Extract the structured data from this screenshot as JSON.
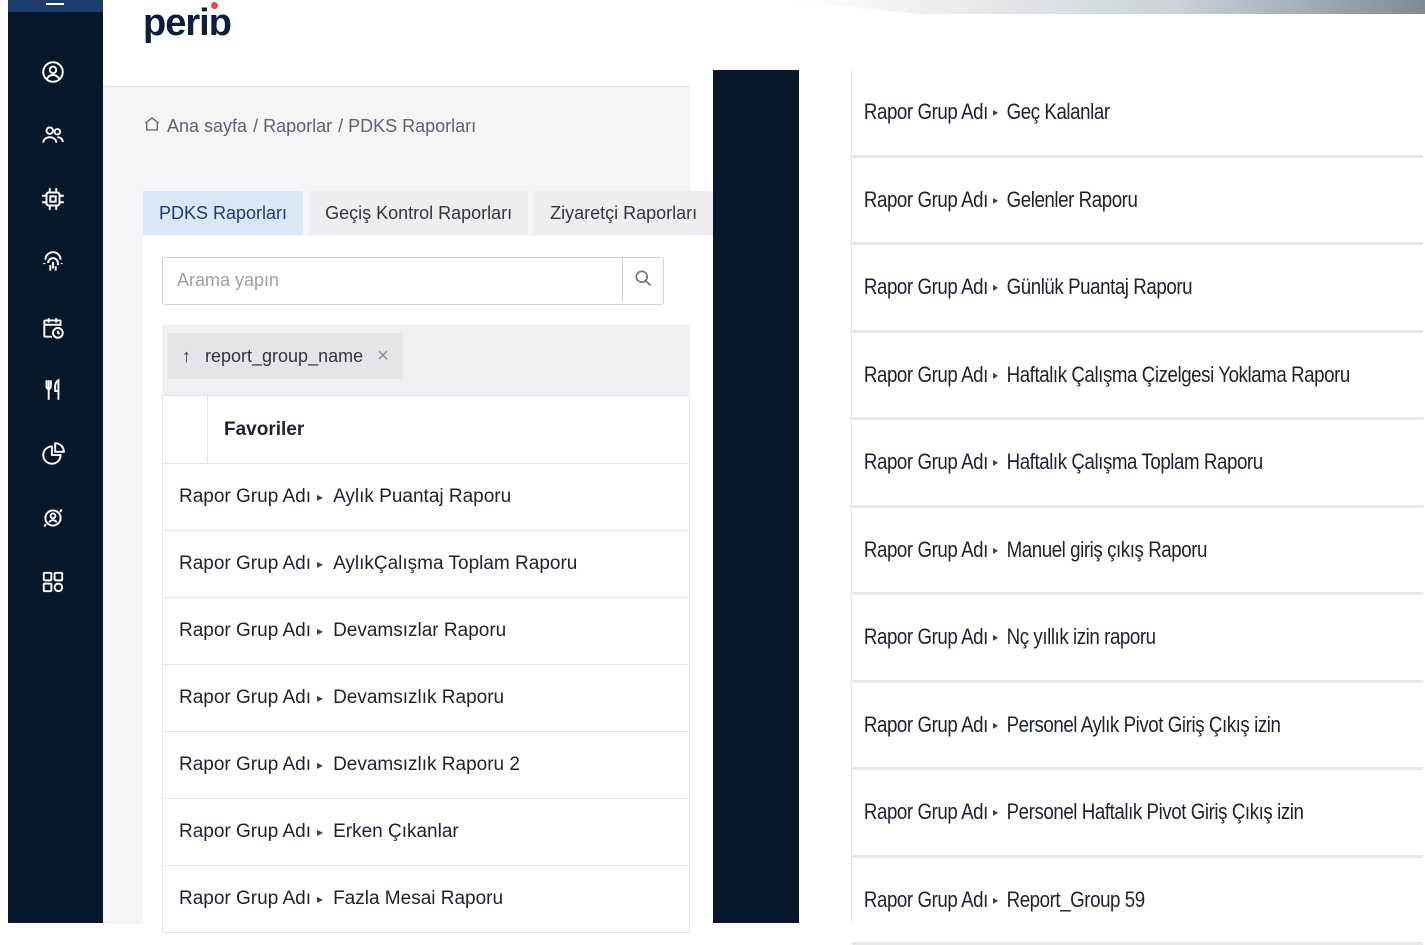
{
  "logo": {
    "text": "periɒ"
  },
  "breadcrumb": {
    "home": "Ana sayfa",
    "items": [
      "/ Raporlar",
      "/ PDKS Raporları"
    ]
  },
  "tabs": [
    {
      "label": "PDKS Raporları",
      "active": true
    },
    {
      "label": "Geçiş Kontrol Raporları",
      "active": false
    },
    {
      "label": "Ziyaretçi Raporları",
      "active": false
    }
  ],
  "search": {
    "placeholder": "Arama yapın"
  },
  "grouping": {
    "arrow": "↑",
    "field": "report_group_name",
    "remove": "×"
  },
  "list": {
    "favorites_label": "Favoriler",
    "group_label": "Rapor Grup Adı",
    "left_rows": [
      "Aylık Puantaj Raporu",
      "AylıkÇalışma Toplam Raporu",
      "Devamsızlar Raporu",
      "Devamsızlık Raporu",
      "Devamsızlık Raporu 2",
      "Erken Çıkanlar",
      "Fazla Mesai Raporu"
    ],
    "right_rows": [
      "Geç Kalanlar",
      "Gelenler Raporu",
      "Günlük Puantaj Raporu",
      "Haftalık Çalışma Çizelgesi Yoklama Raporu",
      "Haftalık Çalışma Toplam Raporu",
      "Manuel giriş çıkış Raporu",
      "Nç yıllık izin raporu",
      "Personel Aylık Pivot Giriş Çıkış izin",
      "Personel Haftalık Pivot Giriş Çıkış izin",
      "Report_Group 59"
    ]
  },
  "sidebar": {
    "icons": [
      "user-circle-icon",
      "users-icon",
      "chip-icon",
      "fingerprint-icon",
      "calendar-clock-icon",
      "fork-knife-icon",
      "pie-chart-icon",
      "user-sync-icon",
      "grid-icon"
    ]
  }
}
